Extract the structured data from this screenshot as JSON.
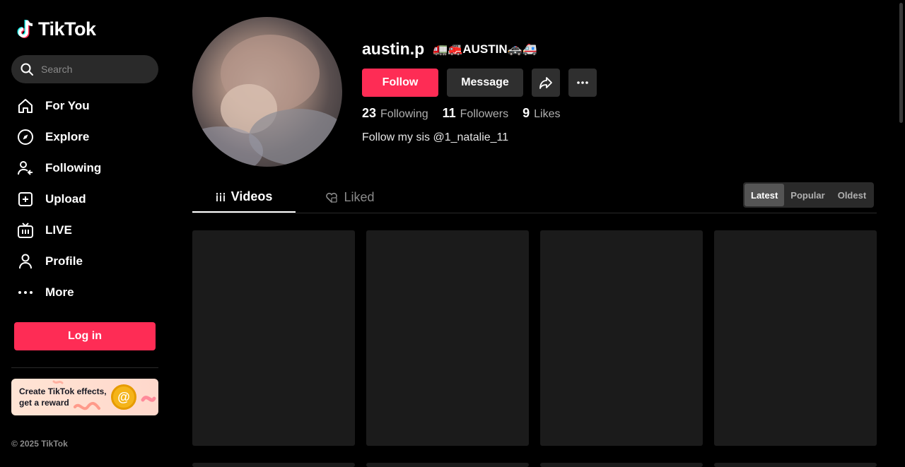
{
  "app": {
    "name": "TikTok"
  },
  "search": {
    "placeholder": "Search"
  },
  "nav": [
    {
      "label": "For You",
      "icon": "home-icon"
    },
    {
      "label": "Explore",
      "icon": "compass-icon"
    },
    {
      "label": "Following",
      "icon": "following-icon"
    },
    {
      "label": "Upload",
      "icon": "upload-icon"
    },
    {
      "label": "LIVE",
      "icon": "live-icon"
    },
    {
      "label": "Profile",
      "icon": "profile-icon"
    },
    {
      "label": "More",
      "icon": "more-icon"
    }
  ],
  "login": {
    "label": "Log in"
  },
  "promo": {
    "text": "Create TikTok effects, get a reward",
    "coin": "@"
  },
  "footer": {
    "copyright": "© 2025 TikTok"
  },
  "profile": {
    "username": "austin.p",
    "nickname": "🚛🚒AUSTIN🚓🚑",
    "follow_label": "Follow",
    "message_label": "Message",
    "stats": [
      {
        "value": "23",
        "label": "Following"
      },
      {
        "value": "11",
        "label": "Followers"
      },
      {
        "value": "9",
        "label": "Likes"
      }
    ],
    "bio": "Follow my sis @1_natalie_11"
  },
  "tabs": {
    "videos": "Videos",
    "liked": "Liked"
  },
  "sort": {
    "options": [
      "Latest",
      "Popular",
      "Oldest"
    ],
    "selected": "Latest"
  },
  "colors": {
    "accent": "#fe2c55",
    "background": "#000000",
    "card": "#1b1b1b"
  }
}
